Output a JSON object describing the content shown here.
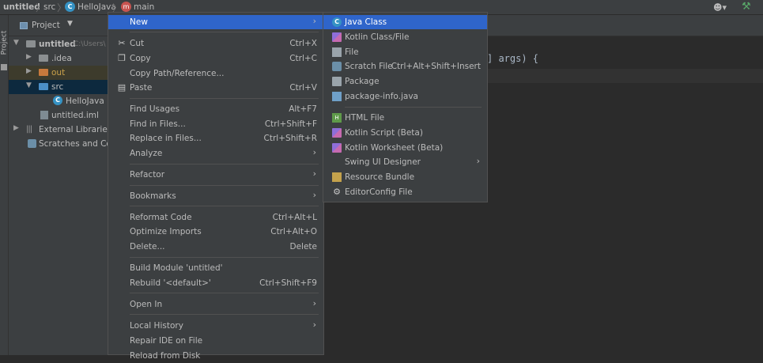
{
  "breadcrumb": {
    "project": "untitled",
    "src": "src",
    "file": "HelloJava",
    "method": "main"
  },
  "icons": {
    "user": "user-icon",
    "build": "hammer-icon"
  },
  "project_panel": {
    "tab_label": "Project",
    "title": "Project",
    "tree": {
      "root": "untitled",
      "root_path": "C:\\Users\\",
      "idea": ".idea",
      "out": "out",
      "src": "src",
      "hellojava": "HelloJava",
      "iml": "untitled.iml",
      "ext_libs": "External Libraries",
      "scratches": "Scratches and Con"
    }
  },
  "editor": {
    "code_fragment": "] args) {"
  },
  "context_menu": {
    "new": "New",
    "cut": "Cut",
    "cut_sc": "Ctrl+X",
    "copy": "Copy",
    "copy_sc": "Ctrl+C",
    "copy_path": "Copy Path/Reference...",
    "paste": "Paste",
    "paste_sc": "Ctrl+V",
    "find_usages": "Find Usages",
    "find_usages_sc": "Alt+F7",
    "find_in_files": "Find in Files...",
    "find_in_files_sc": "Ctrl+Shift+F",
    "replace_in_files": "Replace in Files...",
    "replace_in_files_sc": "Ctrl+Shift+R",
    "analyze": "Analyze",
    "refactor": "Refactor",
    "bookmarks": "Bookmarks",
    "reformat": "Reformat Code",
    "reformat_sc": "Ctrl+Alt+L",
    "optimize": "Optimize Imports",
    "optimize_sc": "Ctrl+Alt+O",
    "delete": "Delete...",
    "delete_sc": "Delete",
    "build_module": "Build Module 'untitled'",
    "rebuild": "Rebuild '<default>'",
    "rebuild_sc": "Ctrl+Shift+F9",
    "open_in": "Open In",
    "local_history": "Local History",
    "repair_ide": "Repair IDE on File",
    "reload": "Reload from Disk"
  },
  "new_submenu": {
    "java_class": "Java Class",
    "kotlin_class": "Kotlin Class/File",
    "file": "File",
    "scratch": "Scratch File",
    "scratch_sc": "Ctrl+Alt+Shift+Insert",
    "package": "Package",
    "package_info": "package-info.java",
    "html": "HTML File",
    "kotlin_script": "Kotlin Script (Beta)",
    "kotlin_worksheet": "Kotlin Worksheet (Beta)",
    "swing": "Swing UI Designer",
    "resource_bundle": "Resource Bundle",
    "editorconfig": "EditorConfig File"
  }
}
